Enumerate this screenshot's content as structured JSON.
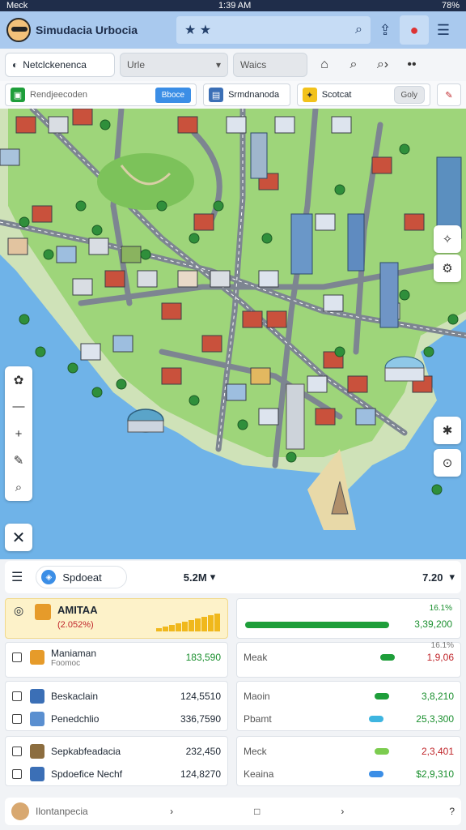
{
  "status": {
    "carrier": "Meck",
    "time": "1:39 AM",
    "battery": "78%"
  },
  "header": {
    "title": "Simudacia Urbocia",
    "search_icons": [
      "star",
      "star"
    ]
  },
  "toolbar": {
    "field_label": "Netclckenenca",
    "select_value": "Urle",
    "search_placeholder": "Waics"
  },
  "filters": {
    "search_text": "Rendjeecoden",
    "search_btn": "Bboce",
    "tool_label": "Srmdnanoda",
    "tool2_label": "Scotcat",
    "tool2_btn": "Goly"
  },
  "map": {
    "labels": []
  },
  "panel": {
    "tab_label": "Spdoeat",
    "center_value": "5.2M",
    "right_value": "7.20",
    "featured": {
      "title": "AMITAA",
      "value": "(2.052%)",
      "pct": "16.1%",
      "amount": "3,39,200",
      "bar_color": "#1e9e3a"
    },
    "rows_left": [
      {
        "name": "Maniaman",
        "sub": "Foomoc",
        "value": "183,590"
      },
      {
        "name": "Beskaclain",
        "value": "124,5510"
      },
      {
        "name": "Penedchlio",
        "value": "336,7590"
      },
      {
        "name": "Sepkabfeadacia",
        "value": "232,450"
      },
      {
        "name": "Spdoefice Nechf",
        "value": "124,8270"
      }
    ],
    "rows_right": [
      {
        "name": "Meak",
        "pct": "16.1%",
        "value": "1,9,06",
        "color": "#1e9e3a",
        "value_color": "#c0262b"
      },
      {
        "name": "Maoin",
        "value": "3,8,210",
        "color": "#1e9e3a",
        "value_color": "#1a8f2e"
      },
      {
        "name": "Pbamt",
        "value": "25,3,300",
        "color": "#3eb5e0",
        "value_color": "#1a8f2e"
      },
      {
        "name": "Meck",
        "value": "2,3,401",
        "color": "#7ccc4f",
        "value_color": "#c0262b"
      },
      {
        "name": "Keaina",
        "value": "$2,9,310",
        "color": "#3b8ee6",
        "value_color": "#1a8f2e"
      }
    ]
  },
  "bottom": {
    "label": "Ilontanpecia"
  }
}
